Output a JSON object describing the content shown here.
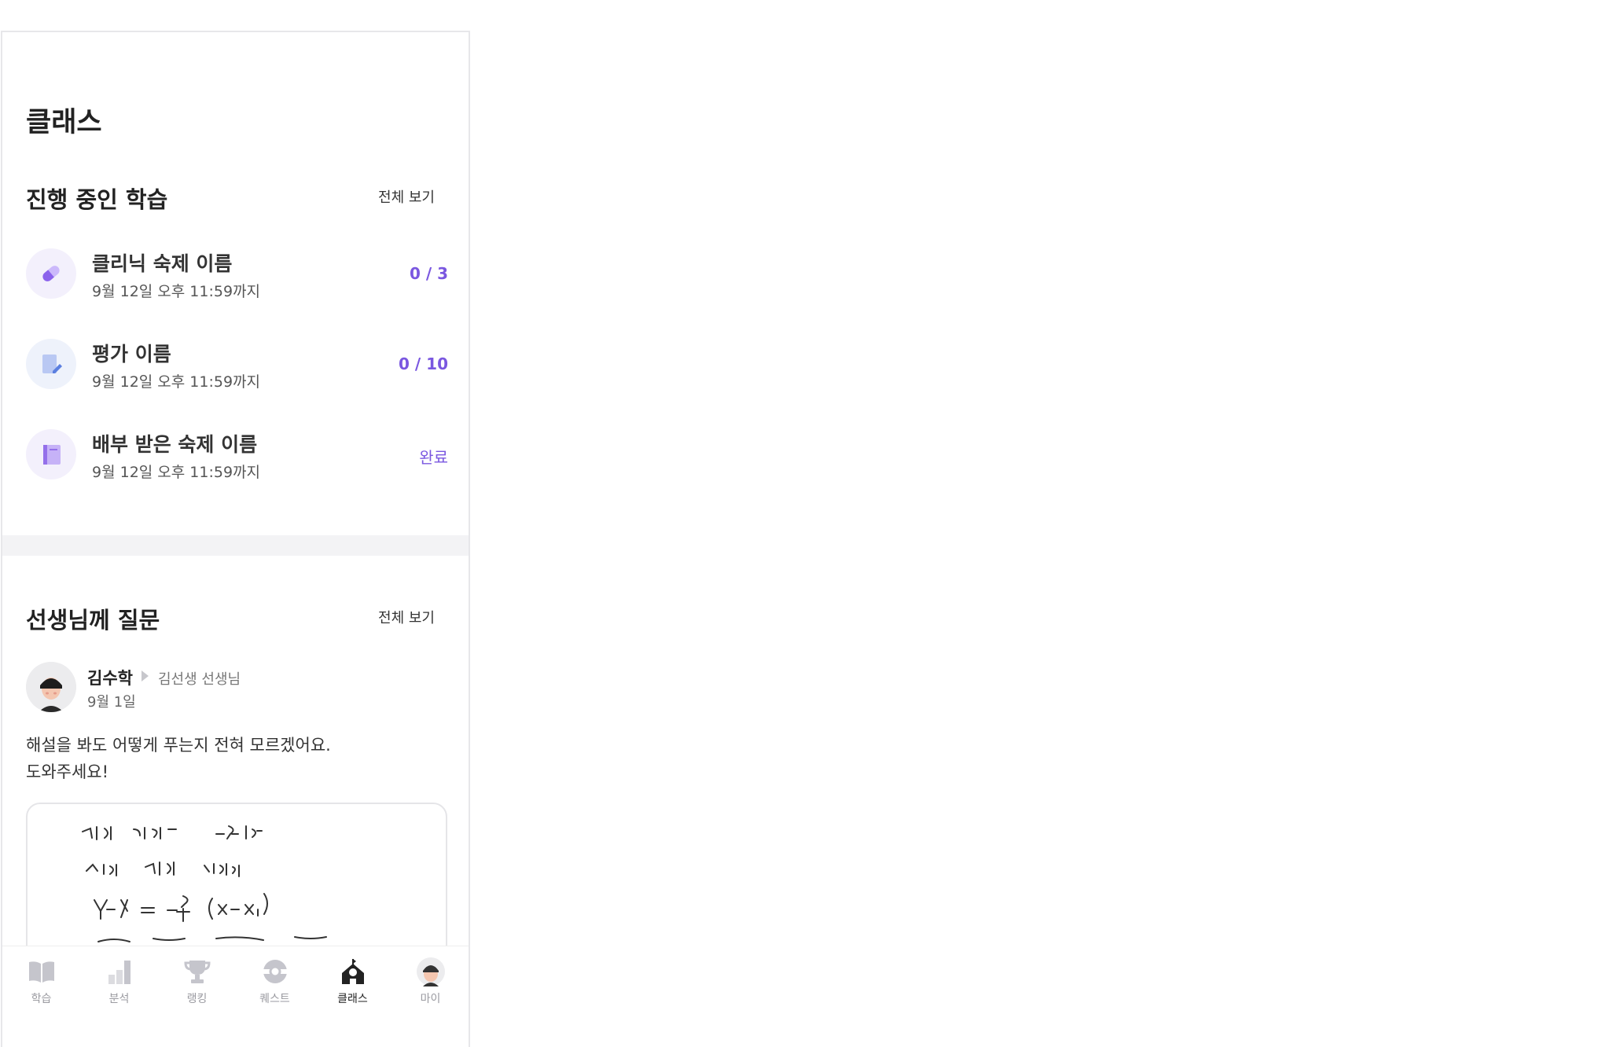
{
  "page": {
    "title": "클래스"
  },
  "in_progress": {
    "title": "진행 중인 학습",
    "see_all": "전체 보기",
    "items": [
      {
        "icon": "pill-icon",
        "title": "클리닉 숙제 이름",
        "due": "9월 12일 오후 11:59까지",
        "status": "0 / 3"
      },
      {
        "icon": "note-edit-icon",
        "title": "평가 이름",
        "due": "9월 12일 오후 11:59까지",
        "status": "0 / 10"
      },
      {
        "icon": "book-icon",
        "title": "배부 받은 숙제 이름",
        "due": "9월 12일 오후 11:59까지",
        "status": "완료"
      }
    ]
  },
  "questions": {
    "title": "선생님께 질문",
    "see_all": "전체 보기",
    "post": {
      "author": "김수학",
      "recipient": "김선생 선생님",
      "date": "9월 1일",
      "text_line1": "해설을 봐도 어떻게 푸는지 전혀 모르겠어요.",
      "text_line2": "도와주세요!"
    }
  },
  "tabs": [
    {
      "label": "학습",
      "icon": "book-open-icon"
    },
    {
      "label": "분석",
      "icon": "bar-chart-icon"
    },
    {
      "label": "랭킹",
      "icon": "trophy-icon"
    },
    {
      "label": "퀘스트",
      "icon": "quest-icon"
    },
    {
      "label": "클래스",
      "icon": "school-icon",
      "active": true
    },
    {
      "label": "마이",
      "icon": "avatar-icon"
    }
  ],
  "colors": {
    "accent": "#7a57e0",
    "divider": "#f3f3f5",
    "inactive": "#c5c5cc"
  }
}
